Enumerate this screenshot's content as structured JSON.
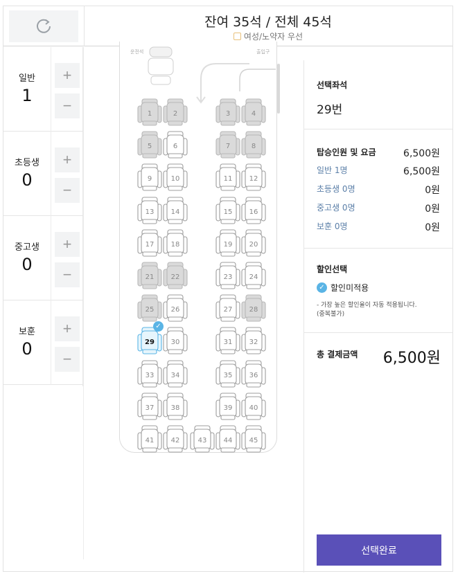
{
  "header": {
    "seat_count": "잔여 35석 / 전체 45석",
    "legend_label": "여성/노약자 우선"
  },
  "passengers": [
    {
      "label": "일반",
      "count": "1",
      "plus": "+",
      "minus": "−"
    },
    {
      "label": "초등생",
      "count": "0",
      "plus": "+",
      "minus": "−"
    },
    {
      "label": "중고생",
      "count": "0",
      "plus": "+",
      "minus": "−"
    },
    {
      "label": "보훈",
      "count": "0",
      "plus": "+",
      "minus": "−"
    }
  ],
  "bus": {
    "front_left_label": "운전석",
    "front_right_label": "출입구"
  },
  "seats": {
    "total": 45,
    "selected": [
      29
    ],
    "occupied": [
      1,
      2,
      3,
      4,
      5,
      7,
      8,
      21,
      22,
      25,
      28
    ],
    "selected_check": "✓"
  },
  "summary": {
    "selected_seat_title": "선택좌석",
    "selected_seat_value": "29번",
    "fare_title": "탑승인원 및 요금",
    "fare_total": "6,500원",
    "fare_lines": [
      {
        "label": "일반 1명",
        "value": "6,500원"
      },
      {
        "label": "초등생 0명",
        "value": "0원"
      },
      {
        "label": "중고생 0명",
        "value": "0원"
      },
      {
        "label": "보훈 0명",
        "value": "0원"
      }
    ],
    "discount_title": "할인선택",
    "discount_option": "할인미적용",
    "discount_note": "- 가장 높은 할인율이 자동 적용됩니다.\n(중복불가)",
    "total_title": "총 결제금액",
    "total_value": "6,500원",
    "confirm_label": "선택완료"
  },
  "colors": {
    "accent": "#5a50b8",
    "selected_seat": "#5ab4e5",
    "occupied_seat": "#d8d8d8"
  },
  "icons": {
    "refresh": "refresh-icon",
    "check": "check-icon"
  }
}
